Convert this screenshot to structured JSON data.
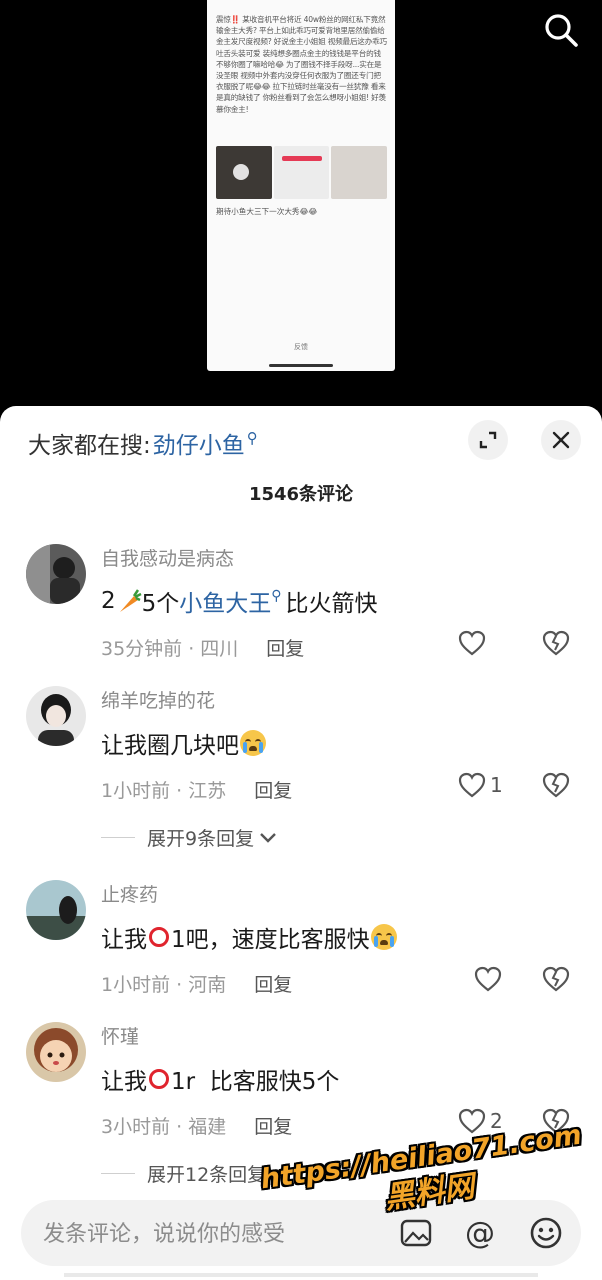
{
  "preview": {
    "text": "震惊‼️ 某收音机平台将近 40w粉丝的网红私下竟然输金主大秀? 平台上如此乖巧可爱背地里居然偷偷给金主发尺度视频? 好说金主小姐姐 视频最后这办乖巧吐舌头装可爱 装纯想多圈点金主的钱钱是平台的钱不够你圈了嘛哈哈😂 为了圈钱不择手段呀...实在是没圣眼 视频中外套内没穿任何衣服为了圈还专门把衣服脱了呢😂😂 拉下拉链时丝毫没有一丝犹豫 看来是真的缺钱了 你粉丝看到了会怎么想呀小姐姐! 好羡慕你金主!",
    "footer": "期待小鱼大三下一次大秀😂😂",
    "button": "反馈"
  },
  "header": {
    "hot_search_prefix": "大家都在搜:",
    "hot_search_keyword": "劲仔小鱼",
    "comment_count": "1546条评论"
  },
  "comments": [
    {
      "name": "自我感动是病态",
      "text_a": "2",
      "text_b": "5个",
      "link": "小鱼大王",
      "text_c": "比火箭快",
      "time_loc": "35分钟前 · 四川",
      "reply": "回复",
      "likes": ""
    },
    {
      "name": "绵羊吃掉的花",
      "text_a": "让我圈几块吧",
      "time_loc": "1小时前 · 江苏",
      "reply": "回复",
      "likes": "1",
      "expand": "展开9条回复"
    },
    {
      "name": "止疼药",
      "text_a": "让我",
      "text_b": "1吧，速度比客服快",
      "time_loc": "1小时前 · 河南",
      "reply": "回复",
      "likes": ""
    },
    {
      "name": "怀瑾",
      "text_a": "让我",
      "text_b": "1r  比客服快5个",
      "time_loc": "3小时前 · 福建",
      "reply": "回复",
      "likes": "2",
      "expand": "展开12条回复"
    }
  ],
  "input": {
    "placeholder": "发条评论，说说你的感受"
  },
  "watermark": {
    "url": "https://heiliao71.com",
    "brand": "黑料网"
  },
  "icons": {
    "search": "search-icon",
    "expand": "expand-icon",
    "close": "close-icon",
    "like": "heart-icon",
    "dislike": "broken-heart-icon",
    "image": "image-icon",
    "at": "at-icon",
    "emoji": "emoji-icon"
  },
  "colors": {
    "link": "#2d64a3",
    "watermark": "#f2a428",
    "sheet": "#ffffff",
    "backdrop": "#000000"
  }
}
